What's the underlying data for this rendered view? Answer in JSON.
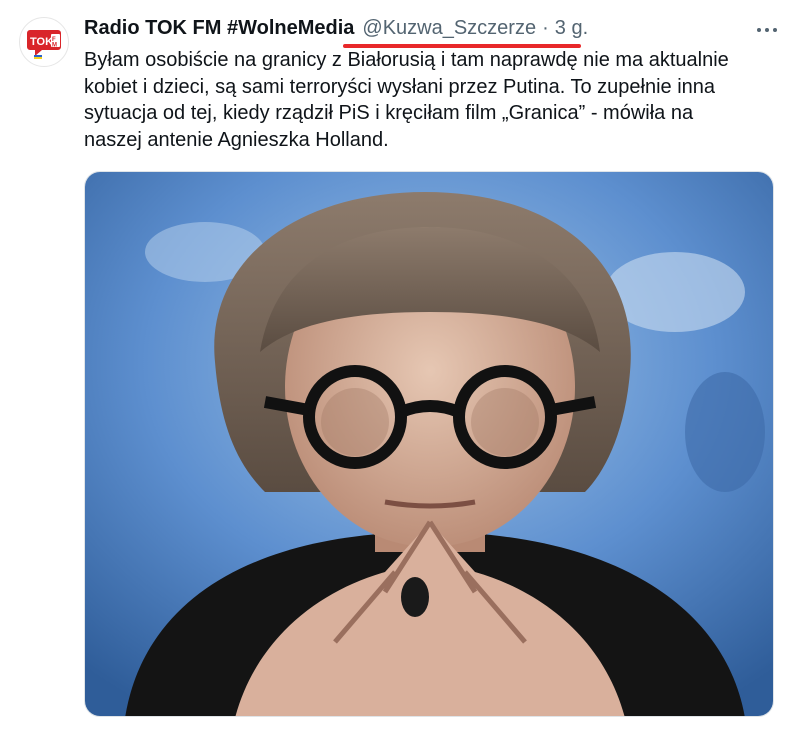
{
  "author": {
    "display_name": "Radio TOK FM #WolneMedia",
    "handle": "@Kuzwa_Szczerze",
    "separator": "·",
    "time": "3 g.",
    "avatar_text": "TOK FM"
  },
  "tweet": {
    "lines": [
      "Byłam osobiście na granicy z Białorusią i tam naprawdę nie ma aktualnie",
      "kobiet i dzieci, są sami terroryści wysłani przez Putina. To zupełnie inna",
      "sytuacja od tej, kiedy rządził PiS i kręciłam film „Granica” - mówiła na",
      "naszej antenie Agnieszka Holland."
    ]
  },
  "icons": {
    "more": "more-horizontal-icon",
    "avatar_logo": "tokfm-logo-icon"
  },
  "colors": {
    "text": "#0f1419",
    "muted": "#536471",
    "underline_annotation": "#e8282a",
    "logo_red": "#d9252a"
  }
}
